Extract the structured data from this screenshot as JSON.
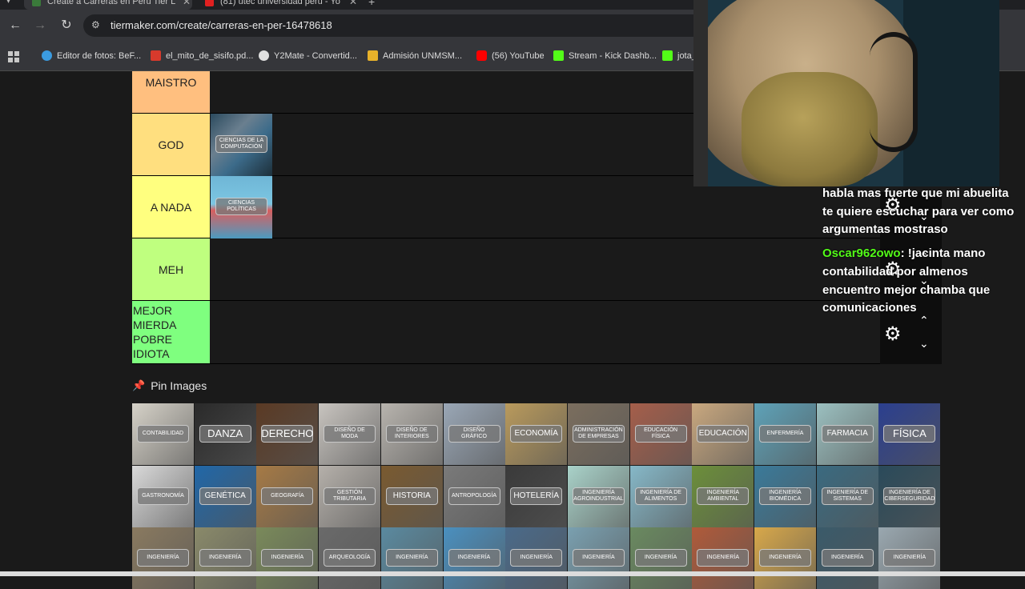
{
  "browser": {
    "tabs": [
      {
        "title": "Create a Carreras en Perú Tier L",
        "favicon_color": "#3a7a3a"
      },
      {
        "title": "(81) utec universidad perú - Yo",
        "favicon_color": "#e02020"
      }
    ],
    "url": "tiermaker.com/create/carreras-en-per-16478618",
    "bookmarks": [
      {
        "label": "Editor de fotos: BeF...",
        "icon_color": "#3b9be0"
      },
      {
        "label": "el_mito_de_sisifo.pd...",
        "icon_color": "#d83a2c"
      },
      {
        "label": "Y2Mate - Convertid...",
        "icon_color": "#e0e0e0"
      },
      {
        "label": "Admisión UNMSM...",
        "icon_color": "#e8b22a"
      },
      {
        "label": "(56) YouTube",
        "icon_color": "#ff0000"
      },
      {
        "label": "Stream - Kick Dashb...",
        "icon_color": "#53fc18"
      },
      {
        "label": "jota_",
        "icon_color": "#53fc18"
      }
    ]
  },
  "tiers": [
    {
      "label": "MAISTRO",
      "color": "#ffbf7f",
      "items": []
    },
    {
      "label": "GOD",
      "color": "#ffdf7f",
      "items": [
        "CIENCIAS DE LA COMPUTACIÓN"
      ]
    },
    {
      "label": "A NADA",
      "color": "#ffff7f",
      "items": [
        "CIENCIAS POLÍTICAS"
      ]
    },
    {
      "label": "MEH",
      "color": "#bfff7f",
      "items": []
    },
    {
      "label": "MEJOR MIERDA POBRE IDIOTA",
      "color": "#7fff7f",
      "items": []
    }
  ],
  "pin_images": {
    "title": "Pin Images",
    "tiles": [
      "CONTABILIDAD",
      "DANZA",
      "DERECHO",
      "DISEÑO DE MODA",
      "DISEÑO DE INTERIORES",
      "DISEÑO GRÁFICO",
      "ECONOMÍA",
      "ADMINISTRACIÓN DE EMPRESAS",
      "EDUCACIÓN FÍSICA",
      "EDUCACIÓN",
      "ENFERMERÍA",
      "FARMACIA",
      "FÍSICA",
      "GASTRONOMÍA",
      "GENÉTICA",
      "GEOGRAFÍA",
      "GESTIÓN TRIBUTARIA",
      "HISTORIA",
      "ANTROPOLOGÍA",
      "HOTELERÍA",
      "INGENIERÍA AGROINDUSTRIAL",
      "INGENIERÍA DE ALIMENTOS",
      "INGENIERÍA AMBIENTAL",
      "INGENIERÍA BIOMÉDICA",
      "INGENIERÍA DE SISTEMAS",
      "INGENIERÍA DE CIBERSEGURIDAD",
      "INGENIERÍA",
      "INGENIERÍA",
      "INGENIERÍA",
      "ARQUEOLOGÍA",
      "INGENIERÍA",
      "INGENIERÍA",
      "INGENIERÍA",
      "INGENIERÍA",
      "INGENIERÍA",
      "INGENIERÍA",
      "INGENIERÍA",
      "INGENIERÍA",
      "INGENIERÍA"
    ]
  },
  "chat": [
    {
      "user": "",
      "text": "habla mas fuerte que mi abuelita te quiere escuchar para ver como argumentas mostraso"
    },
    {
      "user": "Oscar962owo",
      "text": "!jacinta mano contabilidad por almenos encuentro mejor chamba que comunicaciones"
    }
  ]
}
